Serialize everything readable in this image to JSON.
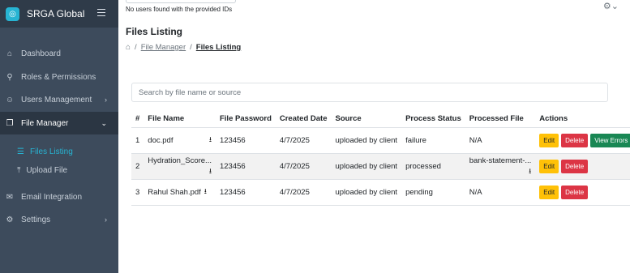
{
  "app": {
    "brand": "SRGA Global",
    "logo_glyph": "◎"
  },
  "sidebar": {
    "items": [
      {
        "label": "Dashboard",
        "icon": "home-icon",
        "glyph": "⌂",
        "chev": ""
      },
      {
        "label": "Roles & Permissions",
        "icon": "lock-icon",
        "glyph": "⌂",
        "chev": ""
      },
      {
        "label": "Users Management",
        "icon": "user-icon",
        "glyph": "☺",
        "chev": "›"
      },
      {
        "label": "File Manager",
        "icon": "file-icon",
        "glyph": "❐",
        "chev": "⌄"
      },
      {
        "label": "Email Integration",
        "icon": "mail-icon",
        "glyph": "✉",
        "chev": ""
      },
      {
        "label": "Settings",
        "icon": "gear-icon",
        "glyph": "⚙",
        "chev": "›"
      }
    ],
    "subitems": [
      {
        "label": "Files Listing",
        "icon": "list-icon",
        "glyph": "☰"
      },
      {
        "label": "Upload File",
        "icon": "upload-icon",
        "glyph": "⤒"
      }
    ]
  },
  "header": {
    "notice": "No users found with the provided IDs",
    "settings_glyph": "⚙⌄"
  },
  "page": {
    "title": "Files Listing",
    "breadcrumb": {
      "home_glyph": "⌂",
      "sep": "/",
      "level1": "File Manager",
      "level2": "Files Listing"
    }
  },
  "search": {
    "placeholder": "Search by file name or source",
    "value": ""
  },
  "table": {
    "headers": [
      "#",
      "File Name",
      "File Password",
      "Created Date",
      "Source",
      "Process Status",
      "Processed File",
      "Actions"
    ],
    "download_glyph": "⭳",
    "rows": [
      {
        "num": "1",
        "file_name": "doc.pdf",
        "password": "123456",
        "date": "4/7/2025",
        "source": "uploaded by client",
        "status": "failure",
        "processed": "N/A",
        "actions": [
          "Edit",
          "Delete",
          "View Errors"
        ]
      },
      {
        "num": "2",
        "file_name": "Hydration_Score...",
        "password": "123456",
        "date": "4/7/2025",
        "source": "uploaded by client",
        "status": "processed",
        "processed": "bank-statement-...",
        "actions": [
          "Edit",
          "Delete"
        ]
      },
      {
        "num": "3",
        "file_name": "Rahul Shah.pdf",
        "password": "123456",
        "date": "4/7/2025",
        "source": "uploaded by client",
        "status": "pending",
        "processed": "N/A",
        "actions": [
          "Edit",
          "Delete"
        ]
      }
    ]
  },
  "colors": {
    "sidebar": "#3d4b5c",
    "accent": "#27b4d3",
    "edit": "#ffc107",
    "delete": "#dc3545",
    "success": "#198754"
  }
}
